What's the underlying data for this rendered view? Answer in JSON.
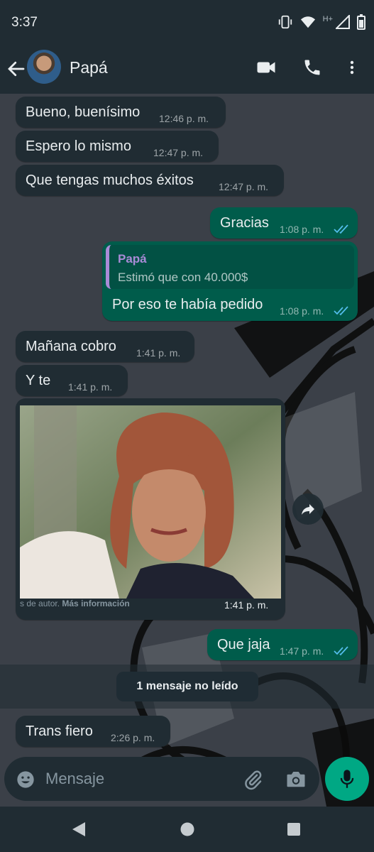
{
  "status_bar": {
    "time": "3:37",
    "network": "H+"
  },
  "header": {
    "contact_name": "Papá"
  },
  "messages": [
    {
      "dir": "in",
      "text": "Bueno, buenísimo",
      "time": "12:46 p. m."
    },
    {
      "dir": "in",
      "text": "Espero lo mismo",
      "time": "12:47 p. m."
    },
    {
      "dir": "in",
      "text": "Que tengas muchos éxitos",
      "time": "12:47 p. m."
    },
    {
      "dir": "out",
      "text": "Gracias",
      "time": "1:08 p. m.",
      "status": "read"
    },
    {
      "dir": "out",
      "text": "Por eso te había pedido",
      "time": "1:08 p. m.",
      "status": "read",
      "quote": {
        "name": "Papá",
        "text": "Estimó que con 40.000$"
      }
    },
    {
      "dir": "in",
      "text": "Mañana cobro",
      "time": "1:41 p. m."
    },
    {
      "dir": "in",
      "text": "Y  te",
      "time": "1:41 p. m."
    },
    {
      "dir": "in",
      "type": "image",
      "caption_prefix": "s de autor.",
      "caption_link": "Más información",
      "time": "1:41 p. m."
    },
    {
      "dir": "out",
      "text": "Que jaja",
      "time": "1:47 p. m.",
      "status": "read"
    },
    {
      "dir": "in",
      "text": "Trans fiero",
      "time": "2:26 p. m."
    }
  ],
  "unread_banner": "1 mensaje no leído",
  "composer": {
    "placeholder": "Mensaje"
  },
  "colors": {
    "incoming": "#202c33",
    "outgoing": "#005c4b",
    "accent": "#00a884",
    "read_ticks": "#53bdeb"
  },
  "icons": [
    "back-arrow-icon",
    "video-call-icon",
    "phone-icon",
    "more-vert-icon",
    "forward-icon",
    "emoji-icon",
    "attach-icon",
    "camera-icon",
    "mic-icon",
    "nav-back-icon",
    "nav-home-icon",
    "nav-recents-icon"
  ]
}
